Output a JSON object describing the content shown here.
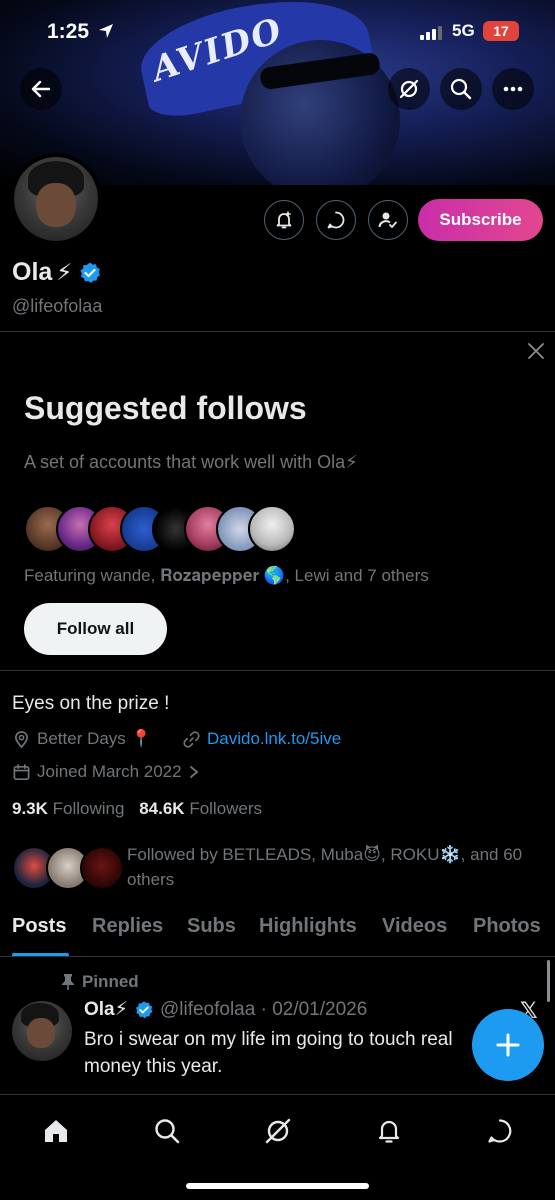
{
  "status_bar": {
    "time": "1:25",
    "network": "5G",
    "battery": "17",
    "battery_color": "#e0443a"
  },
  "banner": {
    "cap_text": "AVIDO"
  },
  "profile": {
    "name": "Ola",
    "name_emoji": "⚡",
    "handle": "@lifeofolaa",
    "subscribe_label": "Subscribe",
    "verified_color": "#1d9bf0"
  },
  "suggested": {
    "title": "Suggested follows",
    "subtitle": "A set of accounts that work well with Ola⚡",
    "featuring": "Featuring wande, 𝐑𝐨𝐳𝐚𝐩𝐞𝐩𝐩𝐞𝐫 🌎, Lewi and 7 others",
    "follow_all_label": "Follow all"
  },
  "bio": {
    "text": "Eyes on the prize !",
    "location": "Better Days 📍",
    "link": "Davido.lnk.to/5ive",
    "joined": "Joined March 2022"
  },
  "stats": {
    "following_count": "9.3K",
    "following_label": "Following",
    "followers_count": "84.6K",
    "followers_label": "Followers"
  },
  "followed_by": "Followed by BETLEADS, Muba😈, ROKU❄️, and 60 others",
  "tabs": [
    {
      "label": "Posts",
      "active": true
    },
    {
      "label": "Replies"
    },
    {
      "label": "Subs"
    },
    {
      "label": "Highlights"
    },
    {
      "label": "Videos"
    },
    {
      "label": "Photos"
    }
  ],
  "pinned_post": {
    "pinned_label": "Pinned",
    "author": "Ola⚡",
    "handle_date": "@lifeofolaa · 02/01/2026",
    "text": "Bro i swear on my life im going to touch real money this year."
  },
  "bottom_nav": [
    "home-icon",
    "search-icon",
    "grok-icon",
    "notifications-icon",
    "messages-icon"
  ],
  "accent_color": "#1d9bf0"
}
